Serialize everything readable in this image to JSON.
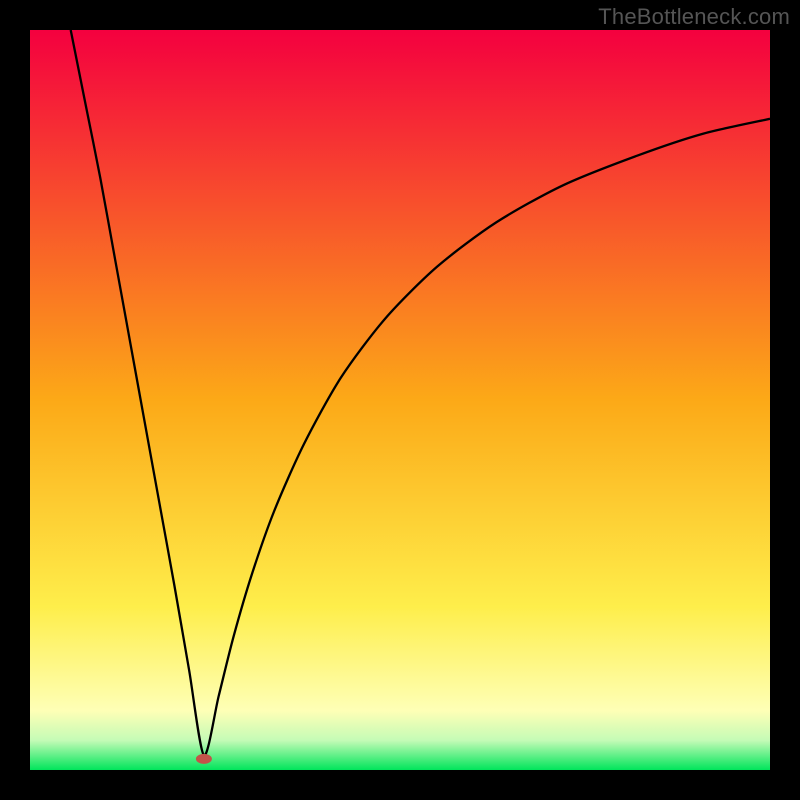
{
  "watermark": "TheBottleneck.com",
  "chart_data": {
    "type": "line",
    "title": "",
    "xlabel": "",
    "ylabel": "",
    "xlim": [
      0,
      1
    ],
    "ylim": [
      0,
      1
    ],
    "grid": false,
    "legend": false,
    "background_gradient": {
      "stops": [
        {
          "t": 0.0,
          "color": "#f4003f"
        },
        {
          "t": 0.5,
          "color": "#fca917"
        },
        {
          "t": 0.78,
          "color": "#feee4b"
        },
        {
          "t": 0.92,
          "color": "#feffb6"
        },
        {
          "t": 0.96,
          "color": "#c4fbb6"
        },
        {
          "t": 1.0,
          "color": "#00e55b"
        }
      ]
    },
    "marker": {
      "x": 0.235,
      "y": 0.985,
      "color": "#c25449"
    },
    "curve": {
      "description": "V-shaped bottleneck curve with minimum at x≈0.235; left branch nearly linear to top-left corner, right branch logarithmic rising toward top-right.",
      "minimum_x": 0.235,
      "minimum_y": 0.98,
      "left_top_x": 0.055,
      "right_end_y": 0.12,
      "points": [
        {
          "x": 0.055,
          "y": 0.0
        },
        {
          "x": 0.075,
          "y": 0.1
        },
        {
          "x": 0.095,
          "y": 0.2
        },
        {
          "x": 0.115,
          "y": 0.31
        },
        {
          "x": 0.135,
          "y": 0.42
        },
        {
          "x": 0.155,
          "y": 0.53
        },
        {
          "x": 0.175,
          "y": 0.64
        },
        {
          "x": 0.195,
          "y": 0.75
        },
        {
          "x": 0.215,
          "y": 0.865
        },
        {
          "x": 0.235,
          "y": 0.98
        },
        {
          "x": 0.255,
          "y": 0.9
        },
        {
          "x": 0.275,
          "y": 0.82
        },
        {
          "x": 0.3,
          "y": 0.735
        },
        {
          "x": 0.33,
          "y": 0.65
        },
        {
          "x": 0.37,
          "y": 0.56
        },
        {
          "x": 0.42,
          "y": 0.47
        },
        {
          "x": 0.48,
          "y": 0.39
        },
        {
          "x": 0.55,
          "y": 0.32
        },
        {
          "x": 0.63,
          "y": 0.26
        },
        {
          "x": 0.72,
          "y": 0.21
        },
        {
          "x": 0.82,
          "y": 0.17
        },
        {
          "x": 0.91,
          "y": 0.14
        },
        {
          "x": 1.0,
          "y": 0.12
        }
      ]
    }
  }
}
